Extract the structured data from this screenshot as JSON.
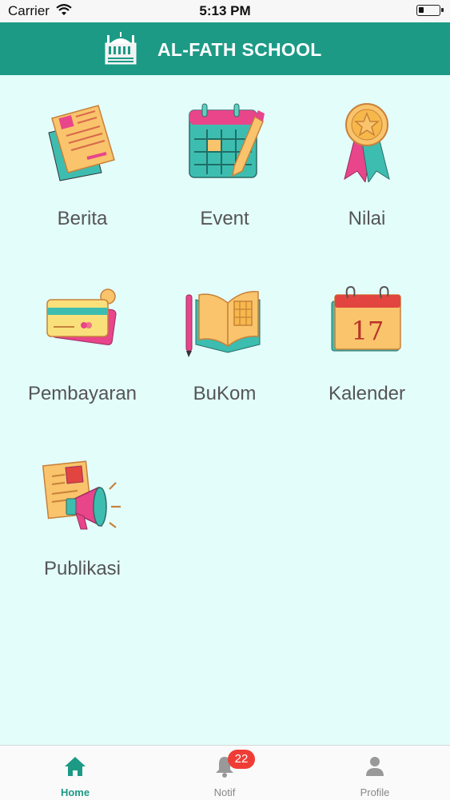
{
  "status_bar": {
    "carrier": "Carrier",
    "time": "5:13 PM"
  },
  "header": {
    "title": "AL-FATH SCHOOL"
  },
  "menu": {
    "items": [
      {
        "label": "Berita",
        "icon": "news-document-icon"
      },
      {
        "label": "Event",
        "icon": "calendar-pencil-icon"
      },
      {
        "label": "Nilai",
        "icon": "award-medal-icon"
      },
      {
        "label": "Pembayaran",
        "icon": "credit-card-icon"
      },
      {
        "label": "BuKom",
        "icon": "open-book-icon"
      },
      {
        "label": "Kalender",
        "icon": "calendar-date-icon"
      },
      {
        "label": "Publikasi",
        "icon": "megaphone-icon"
      }
    ],
    "calendar_day": "17"
  },
  "tab_bar": {
    "tabs": [
      {
        "label": "Home",
        "icon": "home-icon",
        "active": true
      },
      {
        "label": "Notif",
        "icon": "bell-icon",
        "badge": "22"
      },
      {
        "label": "Profile",
        "icon": "person-icon"
      }
    ]
  },
  "colors": {
    "header": "#1c9a86",
    "background": "#e3fdfb",
    "badge": "#ef3d36"
  }
}
